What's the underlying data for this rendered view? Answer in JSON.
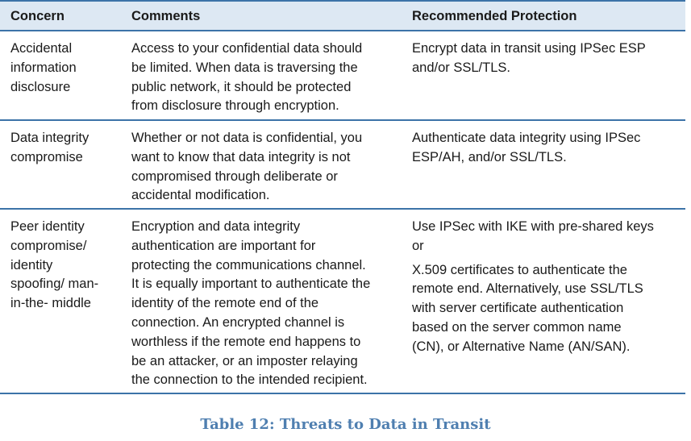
{
  "table": {
    "headers": [
      "Concern",
      "Comments",
      "Recommended Protection"
    ],
    "rows": [
      {
        "concern": [
          "Accidental",
          "information",
          "disclosure"
        ],
        "comments": [
          "Access to your confidential data should",
          "be limited. When data is traversing the",
          "public network, it should be protected",
          "from disclosure through encryption."
        ],
        "protection": [
          "Encrypt data in transit using IPSec ESP",
          "and/or SSL/TLS."
        ]
      },
      {
        "concern": [
          "Data integrity",
          "compromise"
        ],
        "comments": [
          "Whether or not data is confidential, you",
          "want to know that data integrity is not",
          "compromised through deliberate or",
          "accidental modification."
        ],
        "protection": [
          "Authenticate data integrity using IPSec",
          "ESP/AH,  and/or SSL/TLS."
        ]
      },
      {
        "concern": [
          "Peer identity",
          "compromise/",
          "identity",
          "spoofing/ man-",
          "in-the- middle"
        ],
        "comments": [
          "Encryption and data integrity",
          "authentication are important for",
          "protecting the communications  channel.",
          "It is equally important to authenticate the",
          "identity of the remote end of the",
          "connection. An encrypted channel is",
          "worthless if the remote  end happens to",
          "be an attacker, or an imposter relaying",
          "the connection to the intended recipient."
        ],
        "protection_p1": [
          "Use IPSec with IKE with pre-shared keys",
          "or"
        ],
        "protection_p2": [
          "X.509 certificates to authenticate the",
          "remote end. Alternatively, use SSL/TLS",
          "with server certificate authentication",
          "based on the server common name",
          "(CN), or Alternative Name (AN/SAN)."
        ]
      }
    ]
  },
  "caption": "Table 12: Threats to Data in Transit",
  "colors": {
    "header_bg": "#dde8f3",
    "rule": "#3c73a8",
    "caption": "#4f7fb0"
  }
}
